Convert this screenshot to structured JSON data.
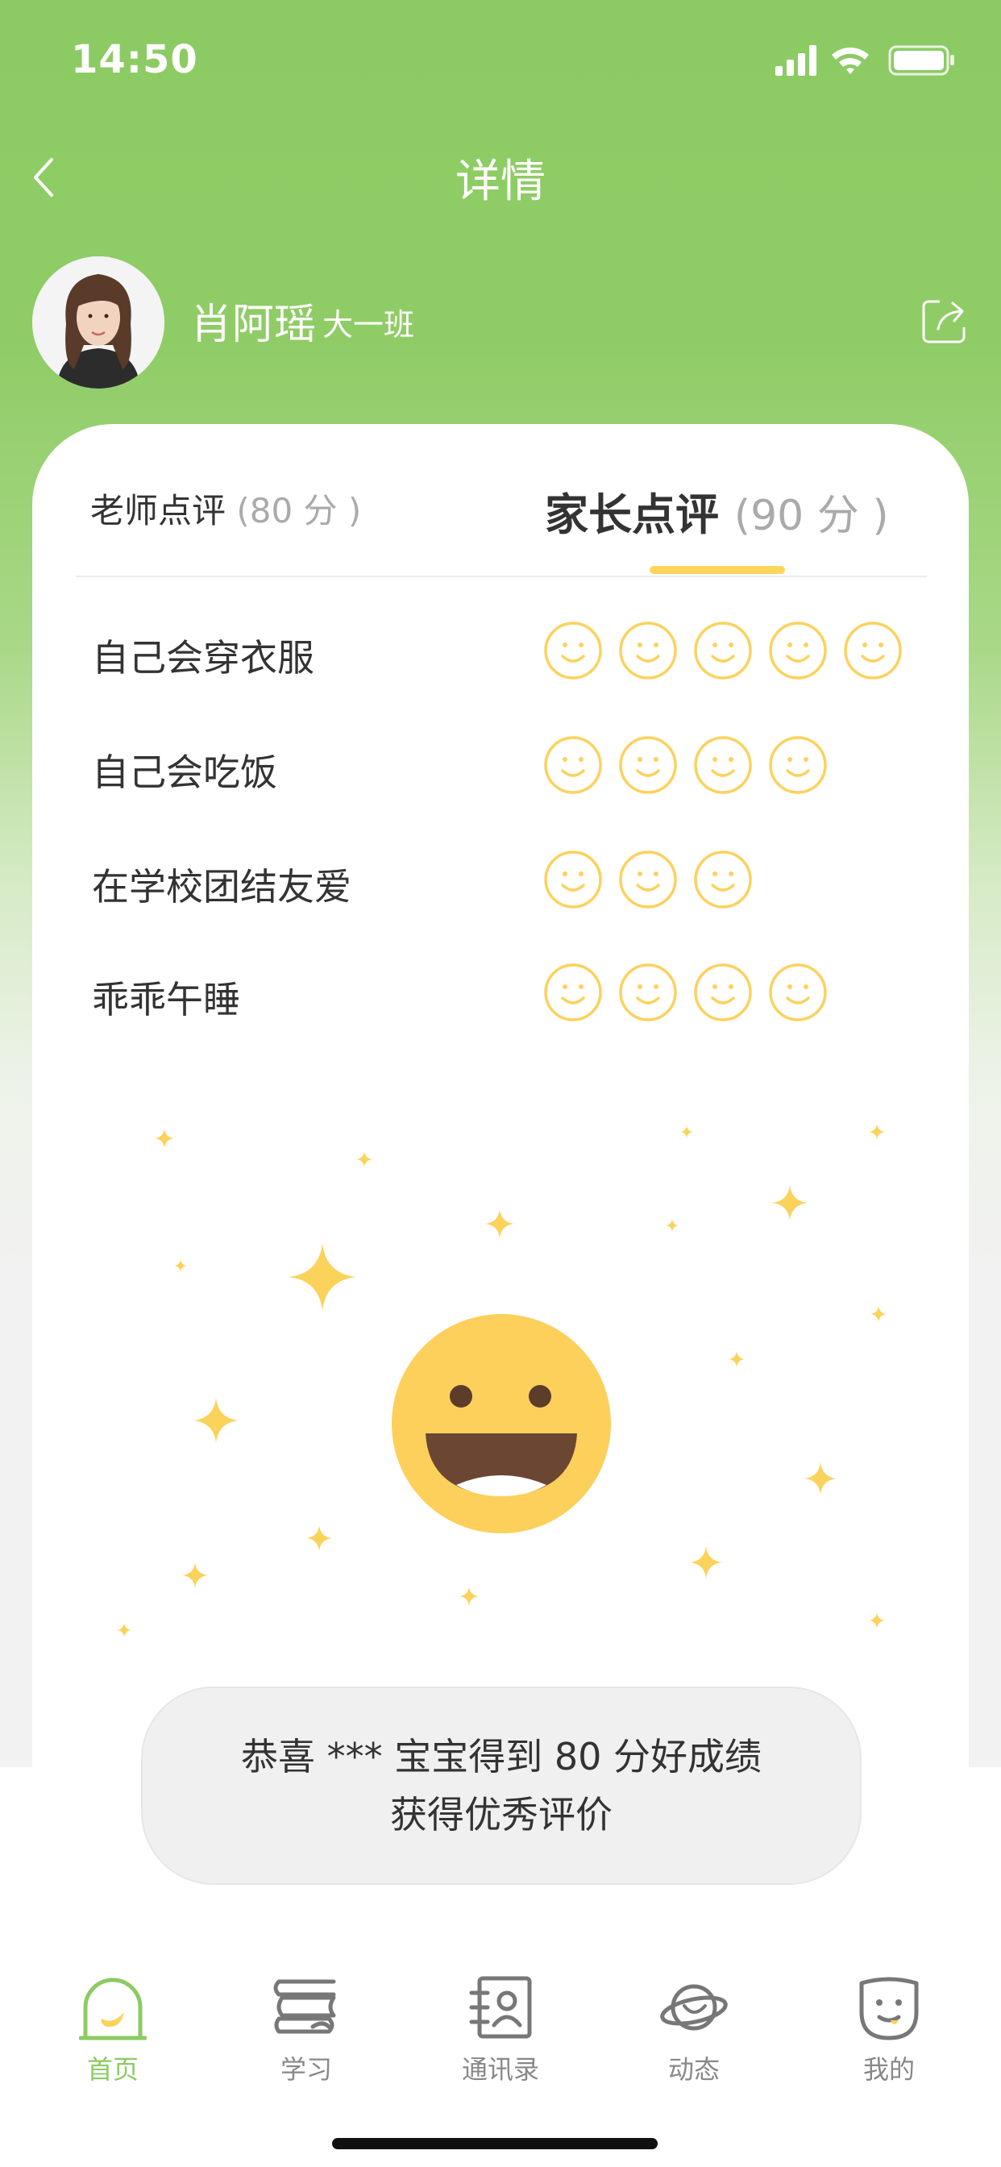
{
  "status_bar": {
    "time": "14:50"
  },
  "nav": {
    "title": "详情",
    "back_icon": "chevron-left-icon"
  },
  "profile": {
    "name": "肖阿瑶",
    "class": "大一班",
    "share_icon": "share-icon"
  },
  "tabs": [
    {
      "label": "老师点评",
      "score": "(80 分 )",
      "active": false
    },
    {
      "label": "家长点评",
      "score": "(90 分 )",
      "active": true
    }
  ],
  "criteria": [
    {
      "label": "自己会穿衣服",
      "rating": 5
    },
    {
      "label": "自己会吃饭",
      "rating": 4
    },
    {
      "label": "在学校团结友爱",
      "rating": 3
    },
    {
      "label": "乖乖午睡",
      "rating": 4
    }
  ],
  "congrats": {
    "line1": "恭喜 *** 宝宝得到 80 分好成绩",
    "line2": "获得优秀评价"
  },
  "tabbar": [
    {
      "label": "首页",
      "icon": "home-icon",
      "active": true
    },
    {
      "label": "学习",
      "icon": "study-icon",
      "active": false
    },
    {
      "label": "通讯录",
      "icon": "contacts-icon",
      "active": false
    },
    {
      "label": "动态",
      "icon": "planet-icon",
      "active": false
    },
    {
      "label": "我的",
      "icon": "profile-face-icon",
      "active": false
    }
  ],
  "colors": {
    "brand_green": "#8ccb63",
    "accent_yellow": "#ffd55c",
    "face_yellow": "#fdd05c"
  }
}
